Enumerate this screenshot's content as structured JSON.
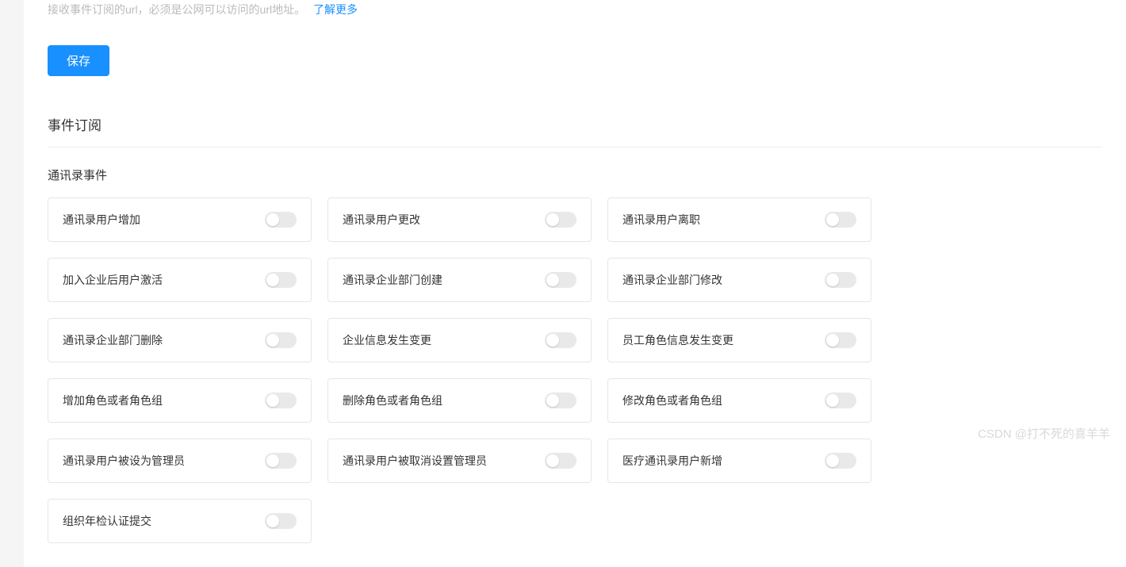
{
  "hint": {
    "text": "接收事件订阅的url，必须是公网可以访问的url地址。",
    "link_text": "了解更多"
  },
  "button": {
    "save_label": "保存"
  },
  "section": {
    "title": "事件订阅",
    "sub_title": "通讯录事件"
  },
  "events": [
    {
      "label": "通讯录用户增加",
      "on": false
    },
    {
      "label": "通讯录用户更改",
      "on": false
    },
    {
      "label": "通讯录用户离职",
      "on": false
    },
    {
      "label": "加入企业后用户激活",
      "on": false
    },
    {
      "label": "通讯录企业部门创建",
      "on": false
    },
    {
      "label": "通讯录企业部门修改",
      "on": false
    },
    {
      "label": "通讯录企业部门删除",
      "on": false
    },
    {
      "label": "企业信息发生变更",
      "on": false
    },
    {
      "label": "员工角色信息发生变更",
      "on": false
    },
    {
      "label": "增加角色或者角色组",
      "on": false
    },
    {
      "label": "删除角色或者角色组",
      "on": false
    },
    {
      "label": "修改角色或者角色组",
      "on": false
    },
    {
      "label": "通讯录用户被设为管理员",
      "on": false
    },
    {
      "label": "通讯录用户被取消设置管理员",
      "on": false
    },
    {
      "label": "医疗通讯录用户新增",
      "on": false
    },
    {
      "label": "组织年检认证提交",
      "on": false
    }
  ],
  "watermark": "CSDN @打不死的喜羊羊"
}
